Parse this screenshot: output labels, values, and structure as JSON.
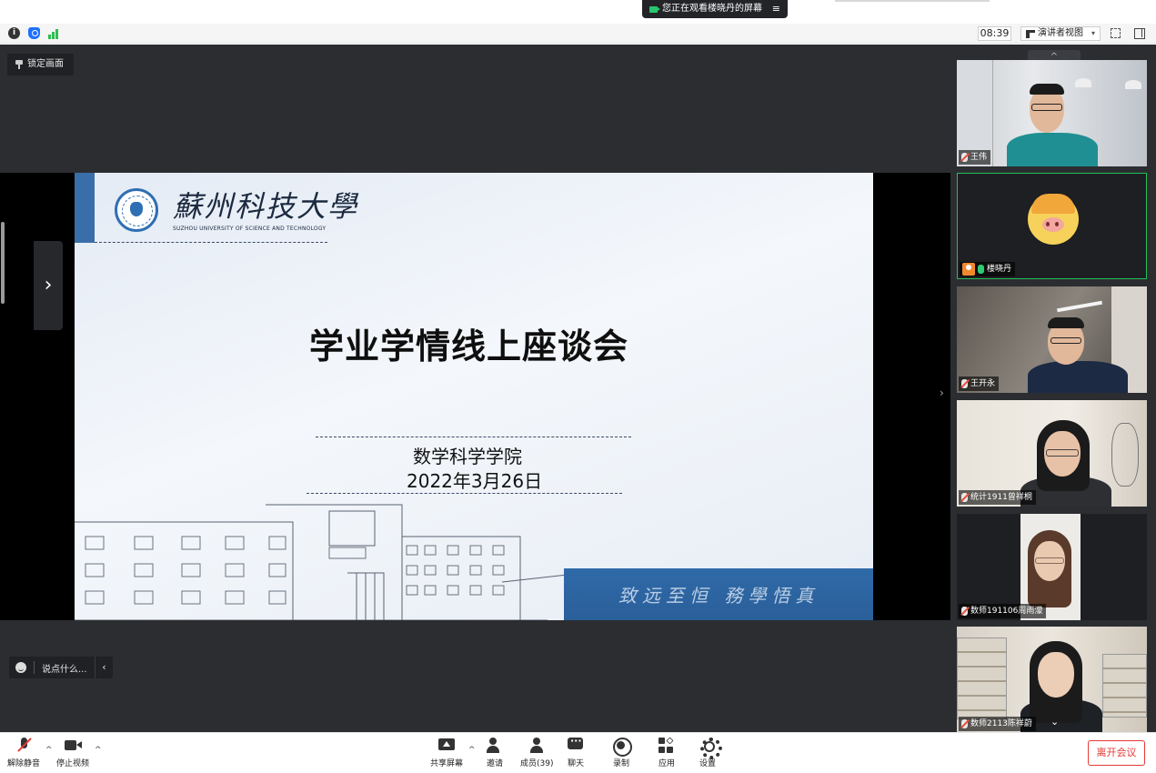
{
  "top_banner": {
    "viewing_text": "您正在观看楼晓丹的屏幕",
    "menu_icon": "list-icon"
  },
  "status_bar": {
    "icons": [
      "info-icon",
      "shield-icon",
      "signal-icon"
    ],
    "timer": "08:39",
    "view_mode": "演讲者视图",
    "view_mode_caret": "▾",
    "fullscreen_icon": "fullscreen-icon",
    "panel_icon": "panel-toggle-icon"
  },
  "stage": {
    "lock_label": "锁定画面",
    "next_arrow": "›",
    "chat_placeholder": "说点什么...",
    "chat_collapse": "‹"
  },
  "slide": {
    "university_cn": "蘇州科技大學",
    "university_en": "SUZHOU UNIVERSITY OF SCIENCE AND TECHNOLOGY",
    "title": "学业学情线上座谈会",
    "organizer": "数学科学学院",
    "date": "2022年3月26日",
    "motto": "致远至恒 務學悟真"
  },
  "participants": [
    {
      "name": "王伟",
      "mic": "muted",
      "host": false
    },
    {
      "name": "楼晓丹",
      "mic": "on",
      "host": true,
      "active": true
    },
    {
      "name": "王开永",
      "mic": "muted",
      "host": false
    },
    {
      "name": "统计1911曾祥桐",
      "mic": "muted",
      "host": false
    },
    {
      "name": "数师191106周雨濛",
      "mic": "muted",
      "host": false
    },
    {
      "name": "数师2113陈祥蔚",
      "mic": "muted",
      "host": false
    }
  ],
  "toolbar": {
    "unmute": "解除静音",
    "stop_video": "停止视频",
    "share_screen": "共享屏幕",
    "invite": "邀请",
    "members": "成员(39)",
    "chat": "聊天",
    "record": "录制",
    "apps": "应用",
    "settings": "设置",
    "leave": "离开会议",
    "caret": "^"
  },
  "colors": {
    "accent_green": "#22c05a",
    "leave_red": "#e53935",
    "stage_bg": "#2b2d31"
  }
}
